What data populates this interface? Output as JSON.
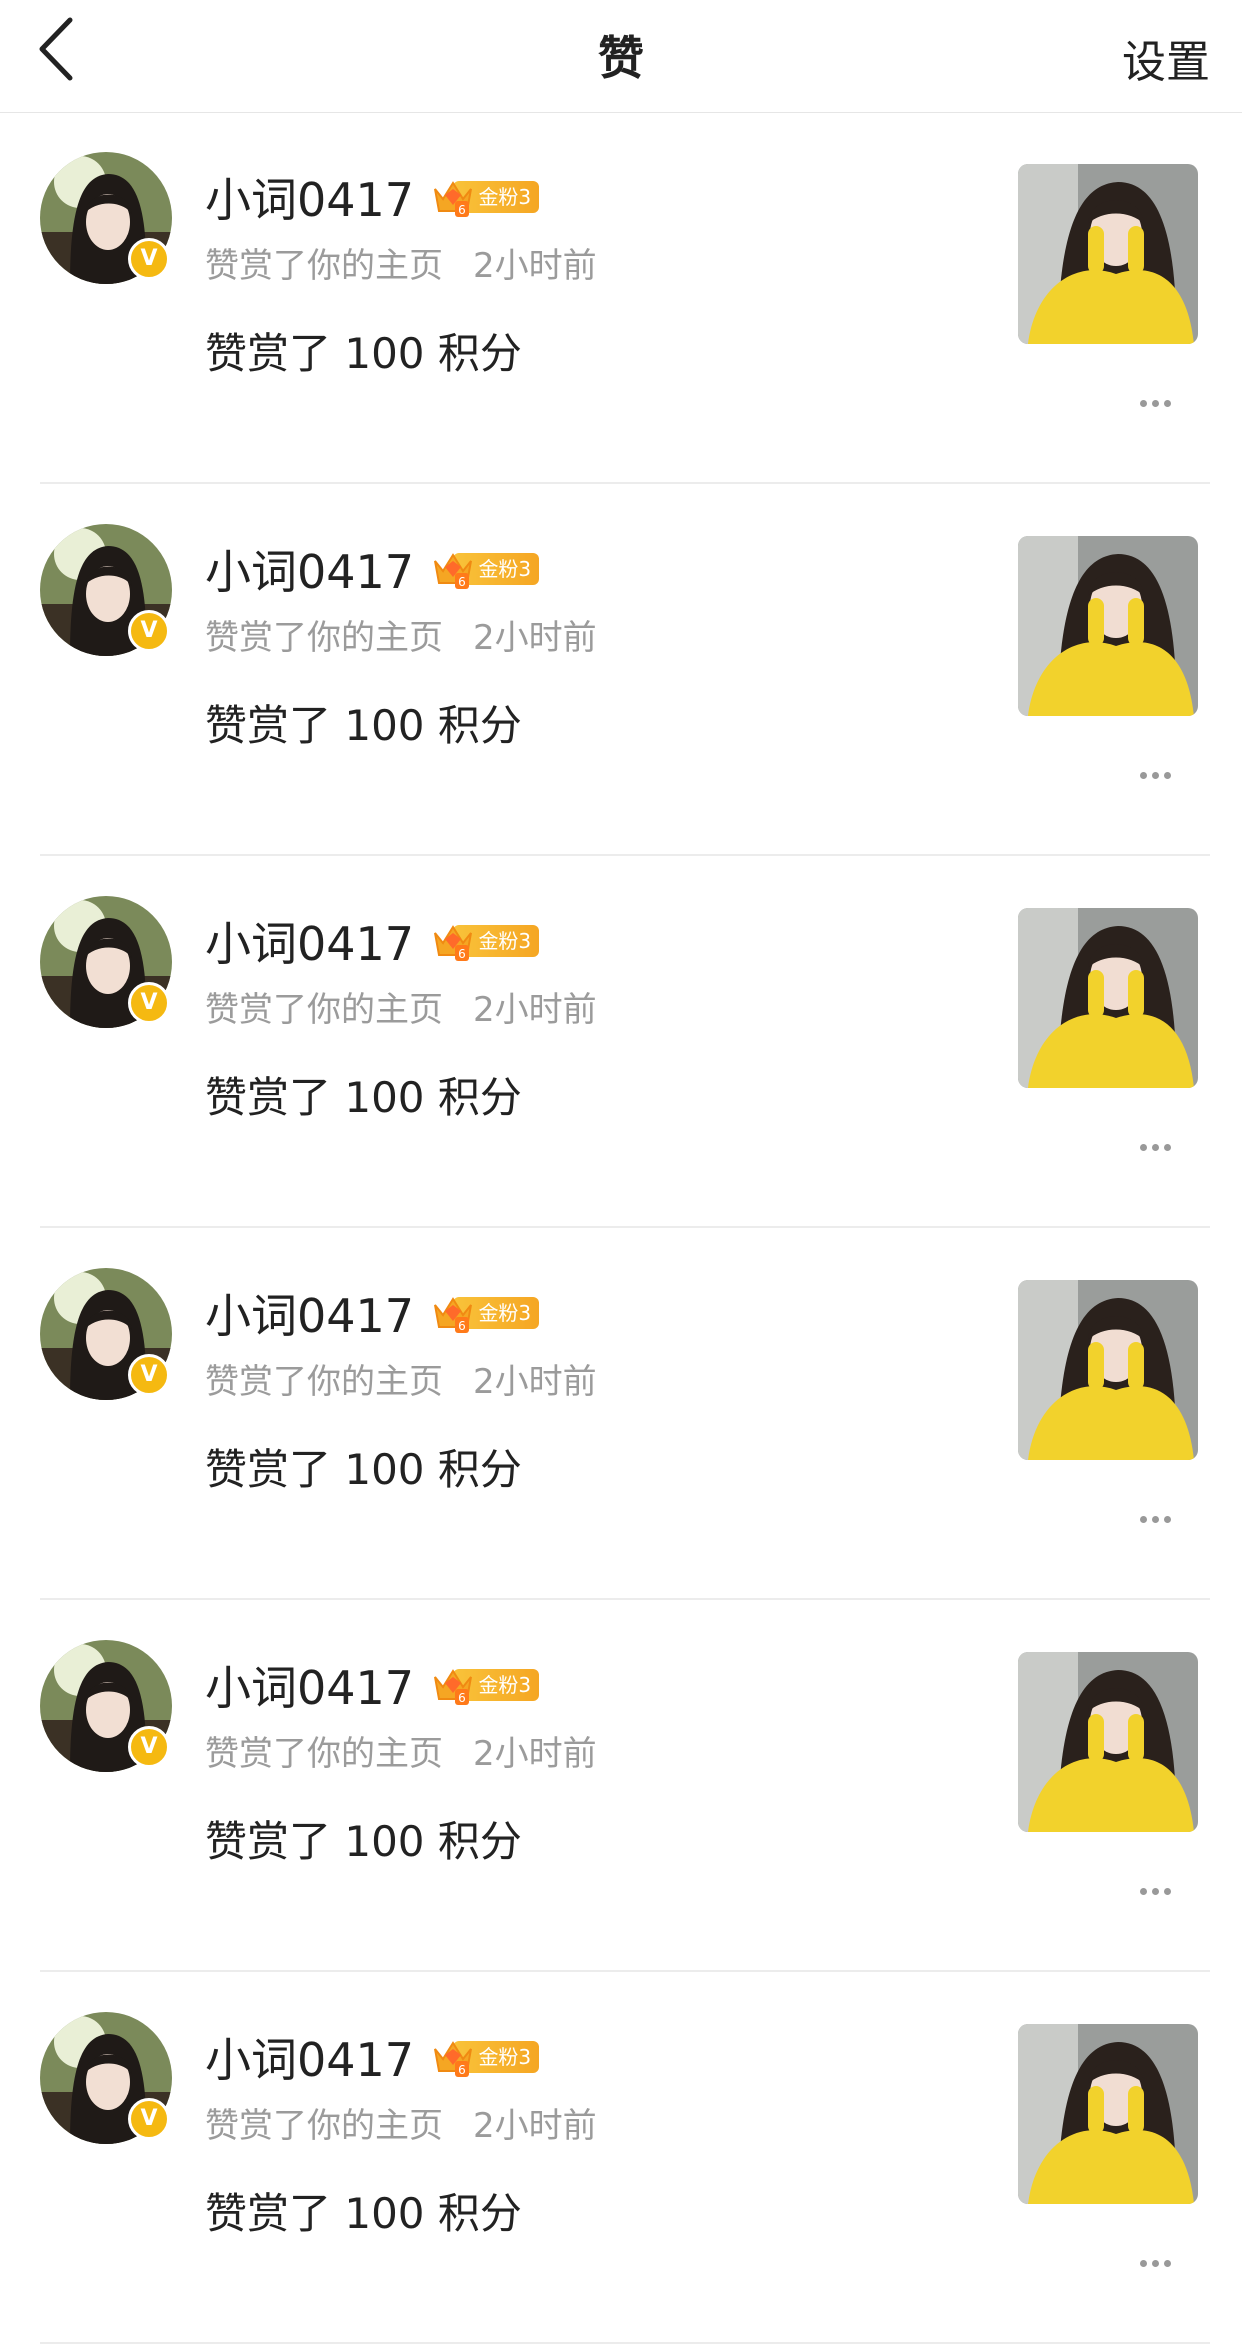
{
  "navbar": {
    "title": "赞",
    "settings_label": "设置"
  },
  "items": [
    {
      "username": "小词0417",
      "fan_badge": "金粉3",
      "fan_level": "6",
      "action": "赞赏了你的主页",
      "time": "2小时前",
      "content": "赞赏了 100 积分"
    },
    {
      "username": "小词0417",
      "fan_badge": "金粉3",
      "fan_level": "6",
      "action": "赞赏了你的主页",
      "time": "2小时前",
      "content": "赞赏了 100 积分"
    },
    {
      "username": "小词0417",
      "fan_badge": "金粉3",
      "fan_level": "6",
      "action": "赞赏了你的主页",
      "time": "2小时前",
      "content": "赞赏了 100 积分"
    },
    {
      "username": "小词0417",
      "fan_badge": "金粉3",
      "fan_level": "6",
      "action": "赞赏了你的主页",
      "time": "2小时前",
      "content": "赞赏了 100 积分"
    },
    {
      "username": "小词0417",
      "fan_badge": "金粉3",
      "fan_level": "6",
      "action": "赞赏了你的主页",
      "time": "2小时前",
      "content": "赞赏了 100 积分"
    },
    {
      "username": "小词0417",
      "fan_badge": "金粉3",
      "fan_level": "6",
      "action": "赞赏了你的主页",
      "time": "2小时前",
      "content": "赞赏了 100 积分"
    }
  ],
  "verified_badge": "V",
  "colors": {
    "accent_gold": "#f5b911",
    "divider": "#ececec",
    "meta_text": "#9b9b9b"
  },
  "icons": {
    "back": "chevron-left-icon",
    "more": "more-dots-icon",
    "verified": "verified-v-icon",
    "crown": "crown-icon"
  }
}
